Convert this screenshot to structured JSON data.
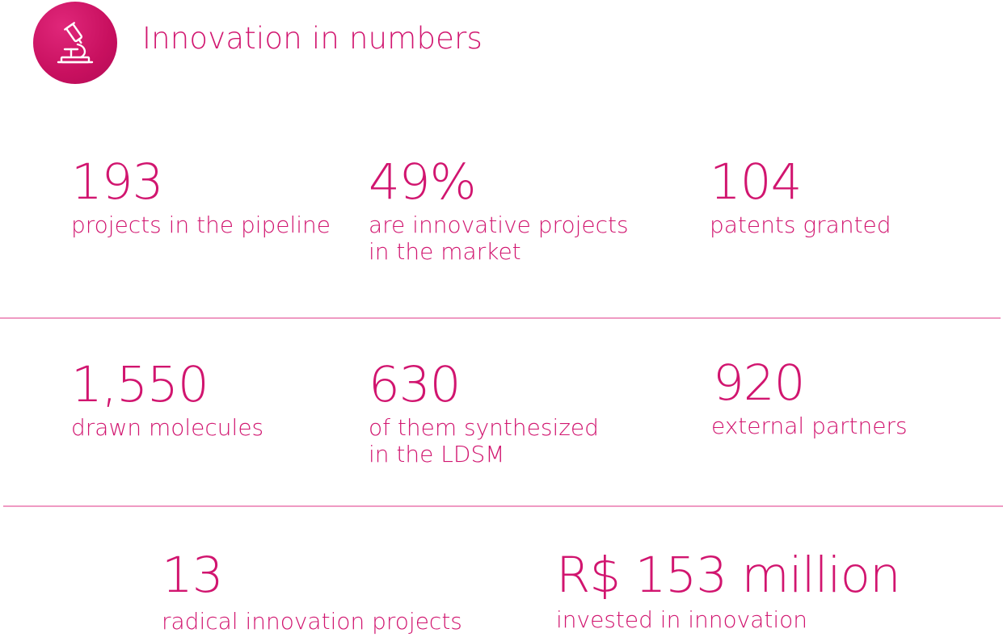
{
  "header": {
    "title": "Innovation in numbers",
    "icon": "microscope-icon",
    "icon_bg": "#c8105f"
  },
  "accent_color": "#d1156f",
  "divider_color": "#ef9ac3",
  "stats": [
    {
      "value": "193",
      "label": "projects in the pipeline"
    },
    {
      "value": "49%",
      "label": "are innovative projects\nin the market"
    },
    {
      "value": "104",
      "label": "patents granted"
    },
    {
      "value": "1,550",
      "label": "drawn molecules"
    },
    {
      "value": "630",
      "label": "of them synthesized\nin the LDSM"
    },
    {
      "value": "920",
      "label": "external partners"
    },
    {
      "value": "13",
      "label": "radical innovation projects"
    },
    {
      "value": "R$ 153 million",
      "label": "invested in innovation"
    }
  ]
}
